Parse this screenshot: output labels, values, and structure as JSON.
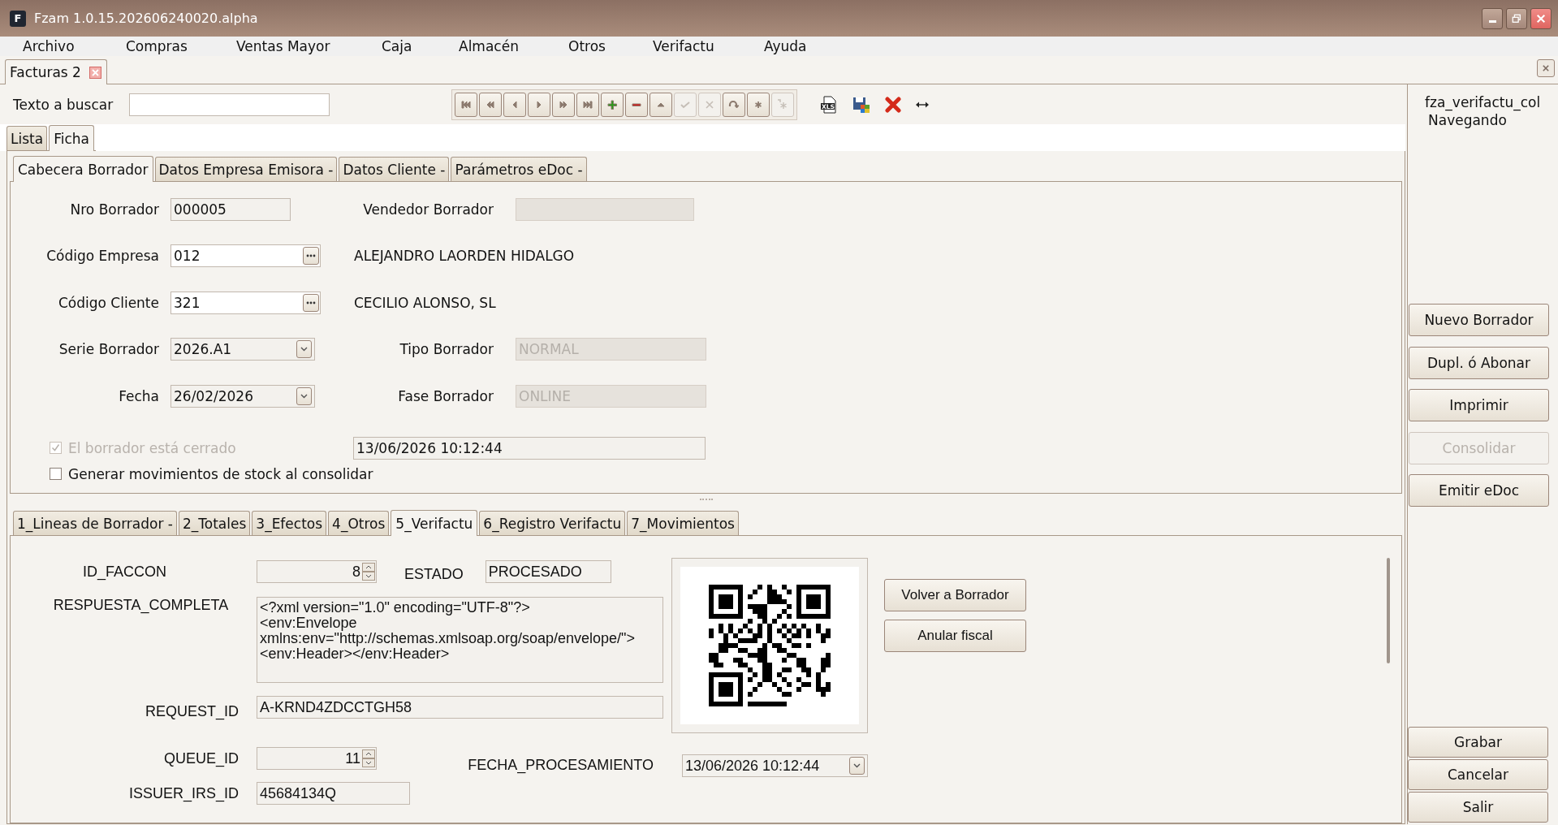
{
  "window": {
    "logo": "F",
    "title": "Fzam 1.0.15.202606240020.alpha"
  },
  "menu": [
    "Archivo",
    "Compras",
    "Ventas Mayor",
    "Caja",
    "Almacén",
    "Otros",
    "Verifactu",
    "Ayuda"
  ],
  "document_tabs": [
    {
      "label": "Facturas 2",
      "selected": true
    }
  ],
  "search": {
    "label": "Texto a buscar"
  },
  "toolbar": [
    {
      "kind": "first",
      "disabled": false
    },
    {
      "kind": "prev-page",
      "disabled": false
    },
    {
      "kind": "prev",
      "disabled": false
    },
    {
      "kind": "next",
      "disabled": false
    },
    {
      "kind": "next-page",
      "disabled": false
    },
    {
      "kind": "last",
      "disabled": false
    },
    {
      "kind": "add",
      "disabled": false
    },
    {
      "kind": "remove",
      "disabled": false
    },
    {
      "kind": "up",
      "disabled": false
    },
    {
      "kind": "confirm",
      "disabled": true
    },
    {
      "kind": "cancel",
      "disabled": true
    },
    {
      "kind": "refresh",
      "disabled": false
    },
    {
      "kind": "asterisk",
      "disabled": false
    },
    {
      "kind": "asterisk-arrow",
      "disabled": true
    }
  ],
  "tools": [
    {
      "kind": "export",
      "text": "XLS"
    },
    {
      "kind": "save"
    },
    {
      "kind": "delete"
    },
    {
      "kind": "resize"
    }
  ],
  "status": {
    "form": "fza_verifactu_col",
    "mode": "Navegando"
  },
  "view_tabs": [
    {
      "label": "Lista",
      "selected": false
    },
    {
      "label": "Ficha",
      "selected": true
    }
  ],
  "section_tabs": [
    {
      "label": "Cabecera Borrador",
      "selected": true
    },
    {
      "label": "Datos Empresa Emisora -",
      "selected": false
    },
    {
      "label": "Datos Cliente -",
      "selected": false
    },
    {
      "label": "Parámetros eDoc -",
      "selected": false
    }
  ],
  "header_rows": [
    {
      "left": {
        "label": "Nro Borrador",
        "value": "000005",
        "kind": "text",
        "editable": false
      },
      "right": {
        "kind": "field",
        "label": "Vendedor Borrador",
        "disabled": true
      }
    },
    {
      "left": {
        "label": "Código Empresa",
        "value": "012",
        "kind": "lookup",
        "editable": true
      },
      "right": {
        "kind": "name",
        "text": "ALEJANDRO LAORDEN HIDALGO"
      }
    },
    {
      "left": {
        "label": "Código Cliente",
        "value": "321",
        "kind": "lookup",
        "editable": true
      },
      "right": {
        "kind": "name",
        "text": "CECILIO ALONSO, SL"
      }
    },
    {
      "left": {
        "label": "Serie Borrador",
        "value": "2026.A1",
        "kind": "combo",
        "editable": false
      },
      "right": {
        "kind": "field",
        "label": "Tipo Borrador",
        "value": "NORMAL",
        "disabled": true
      }
    },
    {
      "left": {
        "label": "Fecha",
        "value": "26/02/2026",
        "kind": "combo",
        "editable": false
      },
      "right": {
        "kind": "field",
        "label": "Fase Borrador",
        "value": "ONLINE",
        "disabled": true
      }
    }
  ],
  "checks": [
    {
      "label": "El borrador está cerrado",
      "checked": true,
      "disabled": true,
      "value": "13/06/2026 10:12:44"
    },
    {
      "label": "Generar movimientos de stock al consolidar",
      "checked": false,
      "disabled": false
    }
  ],
  "bottom_tabs": [
    {
      "label": "1_Lineas de Borrador -",
      "selected": false
    },
    {
      "label": "2_Totales",
      "selected": false
    },
    {
      "label": "3_Efectos",
      "selected": false
    },
    {
      "label": "4_Otros",
      "selected": false
    },
    {
      "label": "5_Verifactu",
      "selected": true
    },
    {
      "label": "6_Registro Verifactu",
      "selected": false
    },
    {
      "label": "7_Movimientos",
      "selected": false
    }
  ],
  "verifactu": {
    "id_faccon": {
      "label": "ID_FACCON",
      "value": "8"
    },
    "estado": {
      "label": "ESTADO",
      "value": "PROCESADO"
    },
    "respuesta_completa": {
      "label": "RESPUESTA_COMPLETA",
      "value": "<?xml version=\"1.0\" encoding=\"UTF-8\"?>\n<env:Envelope\nxmlns:env=\"http://schemas.xmlsoap.org/soap/envelope/\">\n<env:Header></env:Header>"
    },
    "request_id": {
      "label": "REQUEST_ID",
      "value": "A-KRND4ZDCCTGH58"
    },
    "queue_id": {
      "label": "QUEUE_ID",
      "value": "11"
    },
    "fecha_procesamiento": {
      "label": "FECHA_PROCESAMIENTO",
      "value": "13/06/2026 10:12:44"
    },
    "issuer_irs_id": {
      "label": "ISSUER_IRS_ID",
      "value": "45684134Q"
    },
    "actions": [
      "Volver a Borrador",
      "Anular fiscal"
    ]
  },
  "side_buttons": [
    {
      "label": "Nuevo Borrador",
      "disabled": false
    },
    {
      "label": "Dupl. ó Abonar",
      "disabled": false
    },
    {
      "label": "Imprimir",
      "disabled": false
    },
    {
      "label": "Consolidar",
      "disabled": true
    },
    {
      "label": "Emitir eDoc",
      "disabled": false
    }
  ],
  "bottom_buttons": [
    "Grabar",
    "Cancelar",
    "Salir"
  ]
}
